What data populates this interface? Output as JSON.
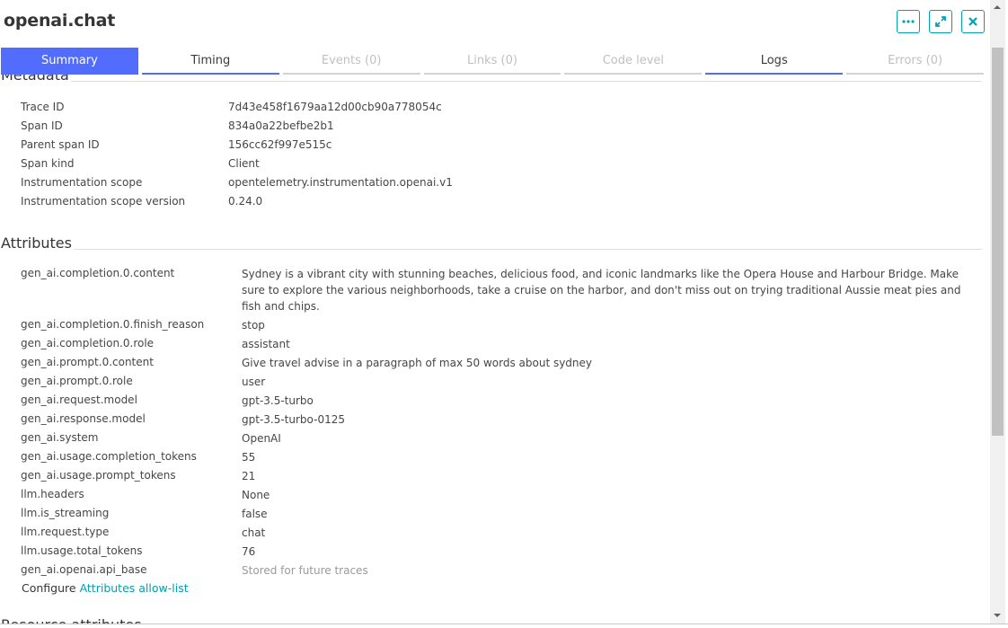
{
  "header": {
    "title": "openai.chat",
    "actions": [
      {
        "name": "more-options-button",
        "icon": "ellipsis-icon"
      },
      {
        "name": "expand-button",
        "icon": "expand-arrows-icon"
      },
      {
        "name": "close-button",
        "icon": "close-icon"
      }
    ]
  },
  "tabs": [
    {
      "label": "Summary",
      "state": "active"
    },
    {
      "label": "Timing",
      "state": "enabled"
    },
    {
      "label": "Events (0)",
      "state": "disabled"
    },
    {
      "label": "Links (0)",
      "state": "disabled"
    },
    {
      "label": "Code level",
      "state": "disabled"
    },
    {
      "label": "Logs",
      "state": "enabled"
    },
    {
      "label": "Errors (0)",
      "state": "disabled"
    }
  ],
  "metadata": {
    "heading": "Metadata",
    "rows": [
      {
        "key": "Trace ID",
        "value": "7d43e458f1679aa12d00cb90a778054c"
      },
      {
        "key": "Span ID",
        "value": "834a0a22befbe2b1"
      },
      {
        "key": "Parent span ID",
        "value": "156cc62f997e515c"
      },
      {
        "key": "Span kind",
        "value": "Client"
      },
      {
        "key": "Instrumentation scope",
        "value": "opentelemetry.instrumentation.openai.v1"
      },
      {
        "key": "Instrumentation scope version",
        "value": "0.24.0"
      }
    ]
  },
  "attributes": {
    "heading": "Attributes",
    "rows": [
      {
        "key": "gen_ai.completion.0.content",
        "value": "Sydney is a vibrant city with stunning beaches, delicious food, and iconic landmarks like the Opera House and Harbour Bridge. Make sure to explore the various neighborhoods, take a cruise on the harbor, and don't miss out on trying traditional Aussie meat pies and fish and chips."
      },
      {
        "key": "gen_ai.completion.0.finish_reason",
        "value": "stop"
      },
      {
        "key": "gen_ai.completion.0.role",
        "value": "assistant"
      },
      {
        "key": "gen_ai.prompt.0.content",
        "value": "Give travel advise in a paragraph of max 50 words about sydney"
      },
      {
        "key": "gen_ai.prompt.0.role",
        "value": "user"
      },
      {
        "key": "gen_ai.request.model",
        "value": "gpt-3.5-turbo"
      },
      {
        "key": "gen_ai.response.model",
        "value": "gpt-3.5-turbo-0125"
      },
      {
        "key": "gen_ai.system",
        "value": "OpenAI"
      },
      {
        "key": "gen_ai.usage.completion_tokens",
        "value": "55"
      },
      {
        "key": "gen_ai.usage.prompt_tokens",
        "value": "21"
      },
      {
        "key": "llm.headers",
        "value": "None"
      },
      {
        "key": "llm.is_streaming",
        "value": "false"
      },
      {
        "key": "llm.request.type",
        "value": "chat"
      },
      {
        "key": "llm.usage.total_tokens",
        "value": "76"
      },
      {
        "key": "gen_ai.openai.api_base",
        "value": "Stored for future traces",
        "muted": true
      }
    ],
    "configure_prefix": "Configure",
    "configure_link": "Attributes allow-list"
  },
  "resource_attributes": {
    "heading": "Resource attributes"
  },
  "colors": {
    "accent": "#526cfe",
    "link": "#00a1b2",
    "text": "#454646",
    "muted": "#9a9a9a"
  }
}
